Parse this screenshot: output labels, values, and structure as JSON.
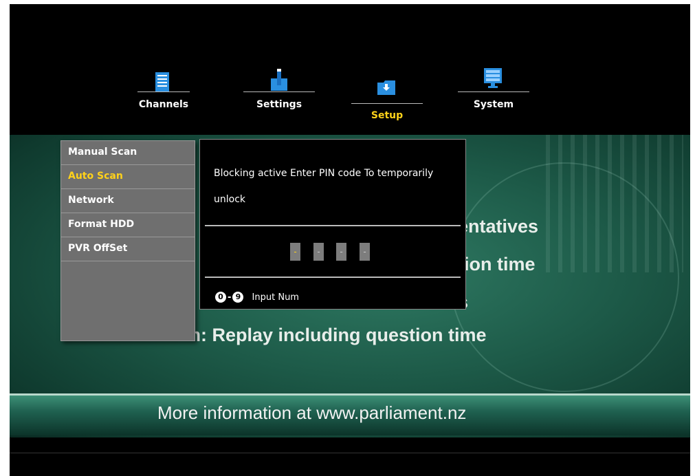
{
  "top_menu": {
    "tabs": [
      {
        "label": "Channels",
        "icon": "channels-icon",
        "active": false
      },
      {
        "label": "Settings",
        "icon": "settings-icon",
        "active": false
      },
      {
        "label": "Setup",
        "icon": "setup-icon",
        "active": true
      },
      {
        "label": "System",
        "icon": "system-icon",
        "active": false
      }
    ]
  },
  "left_menu": {
    "items": [
      {
        "label": "Manual Scan",
        "active": false
      },
      {
        "label": "Auto Scan",
        "active": true
      },
      {
        "label": "Network",
        "active": false
      },
      {
        "label": "Format HDD",
        "active": false
      },
      {
        "label": "PVR OffSet",
        "active": false
      }
    ]
  },
  "pin_dialog": {
    "message": "Blocking active Enter PIN code To temporarily unlock",
    "pin_digits": [
      "-",
      "-",
      "-",
      "-"
    ],
    "hint_badge_start": "0",
    "hint_badge_sep": "-",
    "hint_badge_end": "9",
    "hint_label": "Input Num"
  },
  "tv_content": {
    "line1_visible": "entatives",
    "line2_visible": "tion time",
    "line3_visible": "s",
    "line4_visible": "m: Replay including question time",
    "footer": "More information at www.parliament.nz"
  },
  "colors": {
    "active_text": "#ffd21a",
    "panel_gray": "#6f6f6f",
    "icon_blue": "#2a8fe0"
  }
}
